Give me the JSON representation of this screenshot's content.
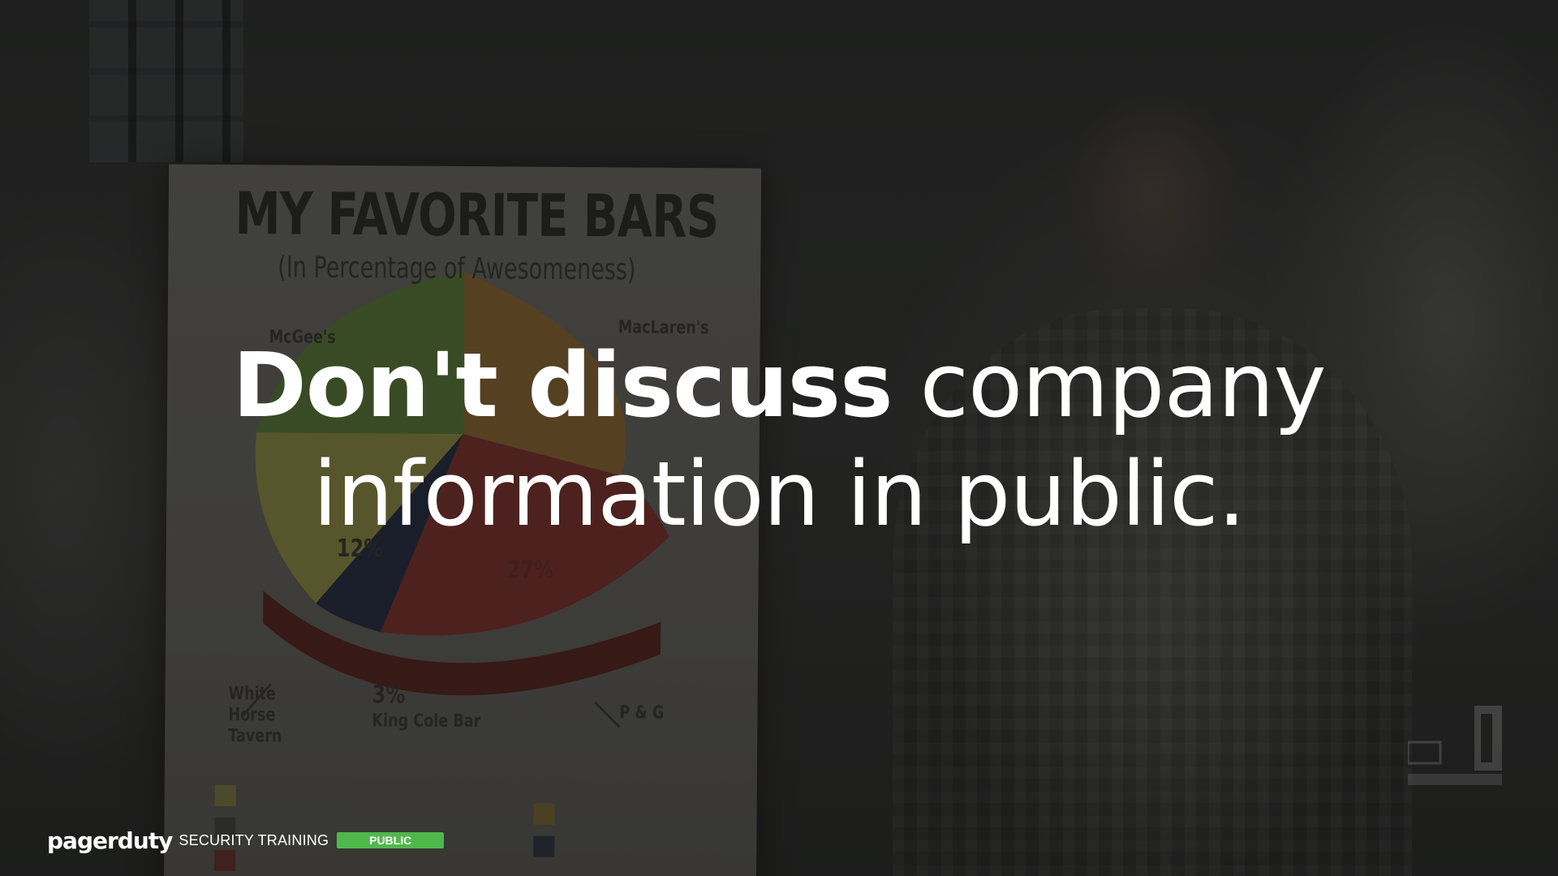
{
  "headline": {
    "bold_part": "Don't discuss",
    "rest_line1": " company",
    "line2": "information in public."
  },
  "poster": {
    "title": "MY FAVORITE BARS",
    "subtitle": "(In Percentage of Awesomeness)",
    "labels": {
      "mcgees": "McGee's",
      "maclarens": "MacLaren's",
      "white_horse": "White Horse Tavern",
      "king_cole": "King Cole Bar",
      "pct_12": "12%",
      "pct_27": "27%",
      "pct_3": "3%",
      "pg": "P & G"
    },
    "colors": {
      "green": "#4f6a2e",
      "yellow": "#7d7a3a",
      "orange": "#7a5a2c",
      "red": "#6e2a25",
      "navy": "#1f2538"
    }
  },
  "footer": {
    "logo": "pagerduty",
    "label": "SECURITY TRAINING",
    "badge": "PUBLIC",
    "badge_color": "#4fb84b"
  }
}
